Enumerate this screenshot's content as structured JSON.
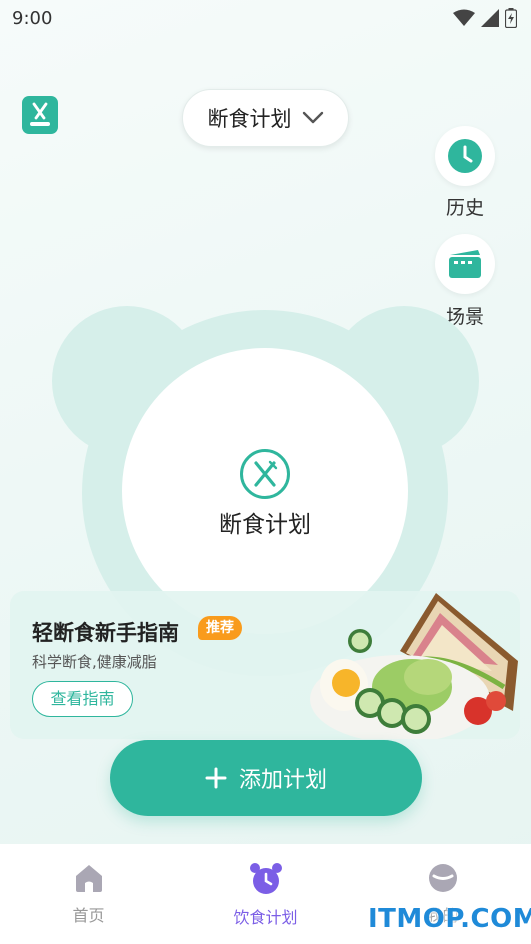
{
  "status_bar": {
    "time": "9:00"
  },
  "header": {
    "plan_selector_label": "断食计划"
  },
  "side_actions": [
    {
      "label": "历史",
      "icon": "clock-icon"
    },
    {
      "label": "场景",
      "icon": "scene-icon"
    }
  ],
  "center": {
    "label": "断食计划",
    "icon": "fork-knife-icon"
  },
  "guide_card": {
    "title": "轻断食新手指南",
    "badge": "推荐",
    "subtitle": "科学断食,健康减脂",
    "button_label": "查看指南"
  },
  "add_plan_button": {
    "label": "添加计划"
  },
  "bottom_nav": {
    "items": [
      {
        "label": "首页",
        "icon": "home-icon",
        "active": false
      },
      {
        "label": "饮食计划",
        "icon": "alarm-clock-icon",
        "active": true
      },
      {
        "label": "我的",
        "icon": "profile-icon",
        "active": false
      }
    ]
  },
  "watermark": "ITMOP.COM",
  "colors": {
    "accent": "#2fb69d",
    "nav_active": "#7b5ee6",
    "badge": "#f99b1c",
    "bear_tint": "#d6efea"
  }
}
